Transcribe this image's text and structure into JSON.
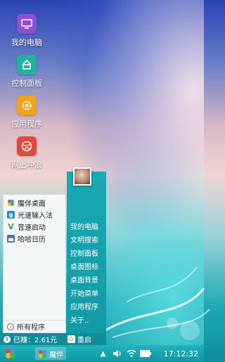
{
  "desktop": {
    "icons": [
      {
        "label": "我的电脑",
        "icon": "monitor-icon",
        "color": "#8e4fd6"
      },
      {
        "label": "控制面板",
        "icon": "control-panel-icon",
        "color": "#1fb3a2"
      },
      {
        "label": "应用程序",
        "icon": "gear-icon",
        "color": "#f0a21a"
      },
      {
        "label": "网上冲浪",
        "icon": "globe-icon",
        "color": "#e2483d"
      }
    ]
  },
  "start_menu": {
    "apps": [
      {
        "label": "魔伴桌面",
        "icon": "pinwheel-icon"
      },
      {
        "label": "光速输入法",
        "icon": "g-input-icon",
        "color": "#2d8bd6"
      },
      {
        "label": "音速启动",
        "icon": "v-check-icon",
        "color": "#3aa53a"
      },
      {
        "label": "哈哈日历",
        "icon": "calendar-icon",
        "color": "#3b78c8"
      }
    ],
    "all_programs": "所有程序",
    "quick_links": [
      "我的电脑",
      "文明搜索",
      "控制面板",
      "桌面图标",
      "桌面背景",
      "开始菜单",
      "应用程序",
      "关于.."
    ],
    "earned": "已赚：2.61元",
    "restart": "重启",
    "accent_color": "#129aa5"
  },
  "taskbar": {
    "task_label": "魔伴",
    "clock": "17:12:32"
  }
}
